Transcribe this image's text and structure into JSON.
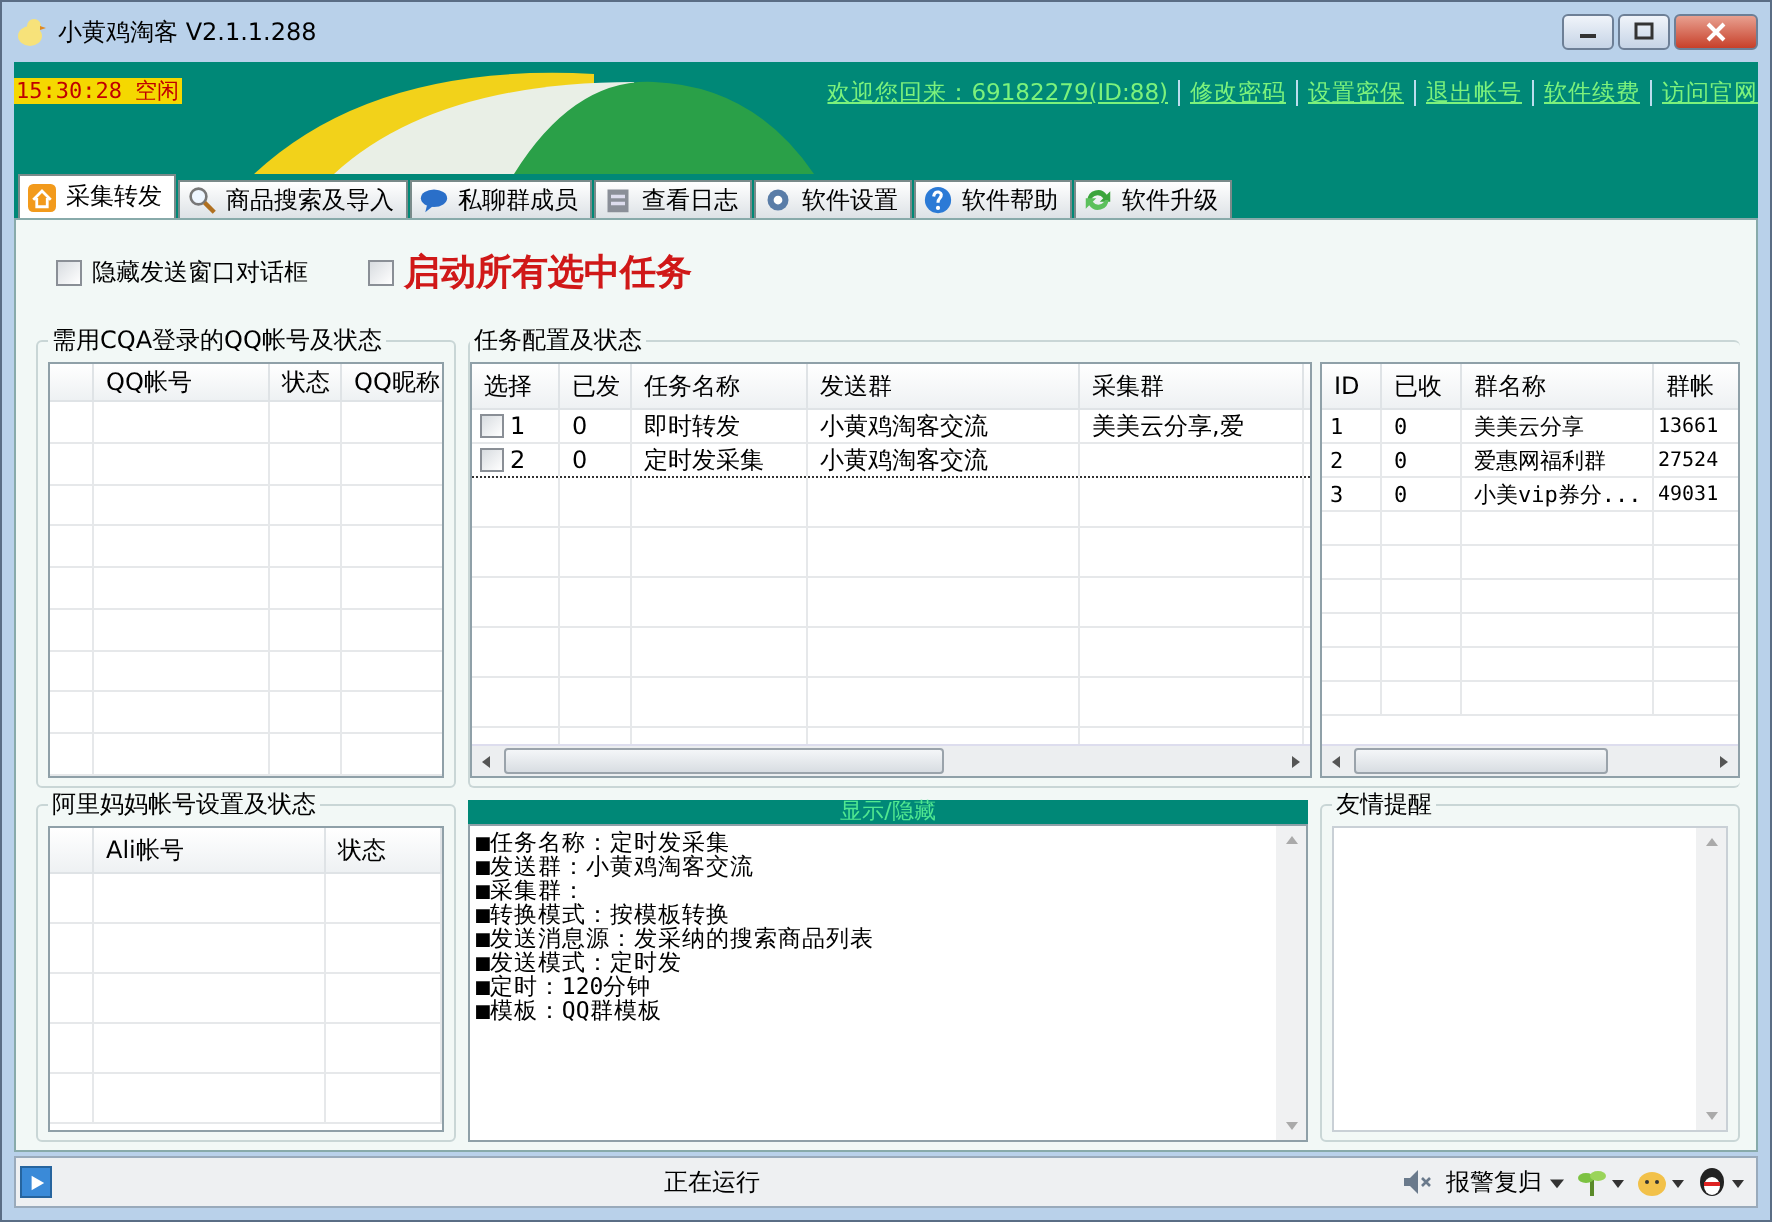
{
  "window": {
    "title": "小黄鸡淘客 V2.1.1.288"
  },
  "header": {
    "clock": "15:30:28",
    "clock_state": "空闲",
    "links": [
      "欢迎您回来：69182279(ID:88)",
      "修改密码",
      "设置密保",
      "退出帐号",
      "软件续费",
      "访问官网"
    ]
  },
  "tabs": [
    {
      "label": "采集转发",
      "kind": "home",
      "selected": true
    },
    {
      "label": "商品搜索及导入",
      "kind": "search",
      "selected": false
    },
    {
      "label": "私聊群成员",
      "kind": "chat",
      "selected": false
    },
    {
      "label": "查看日志",
      "kind": "log",
      "selected": false
    },
    {
      "label": "软件设置",
      "kind": "settings",
      "selected": false
    },
    {
      "label": "软件帮助",
      "kind": "help",
      "selected": false
    },
    {
      "label": "软件升级",
      "kind": "upgrade",
      "selected": false
    }
  ],
  "options": {
    "hide_dialog": {
      "label": "隐藏发送窗口对话框",
      "checked": false
    },
    "start_all": {
      "label": "启动所有选中任务",
      "checked": false
    }
  },
  "qq_panel": {
    "title": "需用CQA登录的QQ帐号及状态",
    "columns": [
      "QQ帐号",
      "状态",
      "QQ昵称"
    ]
  },
  "alimama_panel": {
    "title": "阿里妈妈帐号设置及状态",
    "columns": [
      "Ali帐号",
      "状态"
    ]
  },
  "tasks_panel": {
    "title": "任务配置及状态",
    "columns": [
      "选择",
      "已发",
      "任务名称",
      "发送群",
      "采集群"
    ],
    "rows": [
      {
        "checked": false,
        "selected": false,
        "id": "1",
        "sent": "0",
        "name": "即时转发",
        "send_group": "小黄鸡淘客交流",
        "collect_group": "美美云分享,爱"
      },
      {
        "checked": false,
        "selected": true,
        "id": "2",
        "sent": "0",
        "name": "定时发采集",
        "send_group": "小黄鸡淘客交流",
        "collect_group": ""
      }
    ]
  },
  "groups_table": {
    "columns": [
      "ID",
      "已收",
      "群名称",
      "群帐"
    ],
    "rows": [
      {
        "id": "1",
        "received": "0",
        "name": "美美云分享",
        "account": "13661"
      },
      {
        "id": "2",
        "received": "0",
        "name": "爱惠网福利群",
        "account": "27524"
      },
      {
        "id": "3",
        "received": "0",
        "name": "小美vip券分...",
        "account": "49031"
      }
    ]
  },
  "details": {
    "toggle": "显示/隐藏",
    "lines": [
      "■任务名称：定时发采集",
      "■发送群：小黄鸡淘客交流",
      "■采集群：",
      "■转换模式：按模板转换",
      "■发送消息源：发采纳的搜索商品列表",
      "■发送模式：定时发",
      "■定时：120分钟",
      "■模板：QQ群模板"
    ]
  },
  "reminder": {
    "title": "友情提醒"
  },
  "status_bar": {
    "status": "正在运行",
    "alarm": "报警复归"
  }
}
